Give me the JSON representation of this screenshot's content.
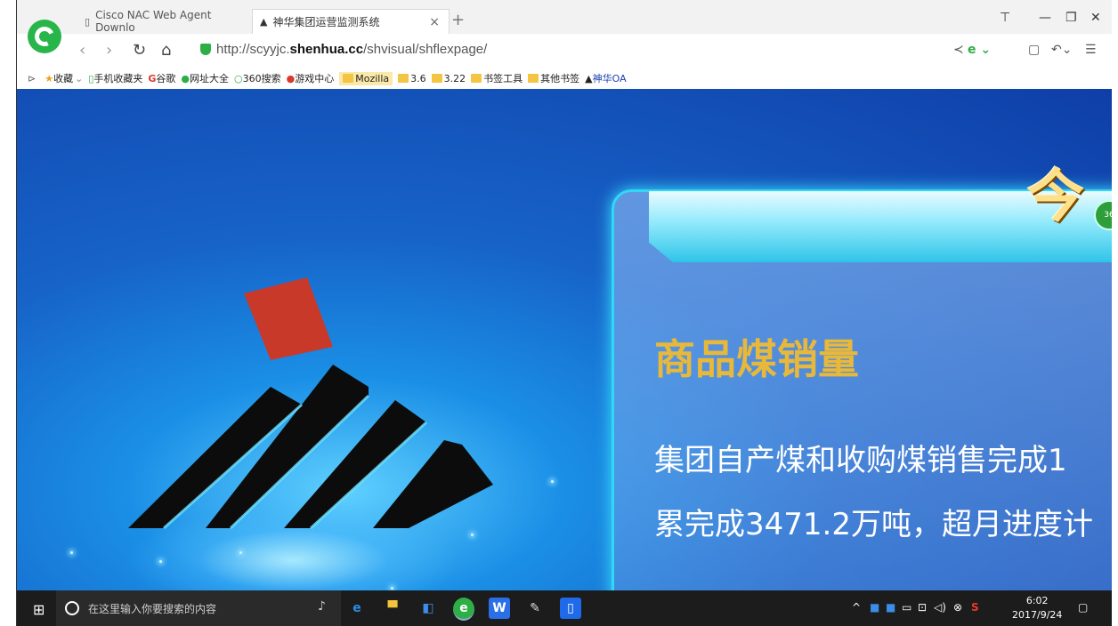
{
  "browser": {
    "tabs": [
      {
        "label": "Cisco NAC Web Agent Downlo"
      },
      {
        "label": "神华集团运营监测系统"
      }
    ],
    "url_prefix": "http://scyyjc.",
    "url_domain": "shenhua.cc",
    "url_path": "/shvisual/shflexpage/"
  },
  "bookmarks": [
    {
      "label": "收藏",
      "icon": "star-icon"
    },
    {
      "label": "手机收藏夹",
      "icon": "phone-icon"
    },
    {
      "label": "谷歌",
      "icon": "google-icon"
    },
    {
      "label": "网址大全",
      "icon": "globe-icon"
    },
    {
      "label": "360搜索",
      "icon": "360-icon"
    },
    {
      "label": "游戏中心",
      "icon": "game-icon"
    },
    {
      "label": "Mozilla",
      "icon": "folder-icon"
    },
    {
      "label": "3.6",
      "icon": "folder-icon"
    },
    {
      "label": "3.22",
      "icon": "folder-icon"
    },
    {
      "label": "书签工具",
      "icon": "folder-icon"
    },
    {
      "label": "其他书签",
      "icon": "folder-icon"
    },
    {
      "label": "神华OA",
      "icon": "shenhua-logo-icon"
    }
  ],
  "content": {
    "banner_char": "今",
    "panel_title": "商品煤销量",
    "line1": "集团自产煤和收购煤销售完成1",
    "line2": "累完成3471.2万吨，超月进度计"
  },
  "taskbar": {
    "search_placeholder": "在这里输入你要搜索的内容",
    "time": "6:02",
    "date": "2017/9/24"
  },
  "colors": {
    "accent_title": "#e8b83a",
    "panel_border": "#31d8f5"
  }
}
